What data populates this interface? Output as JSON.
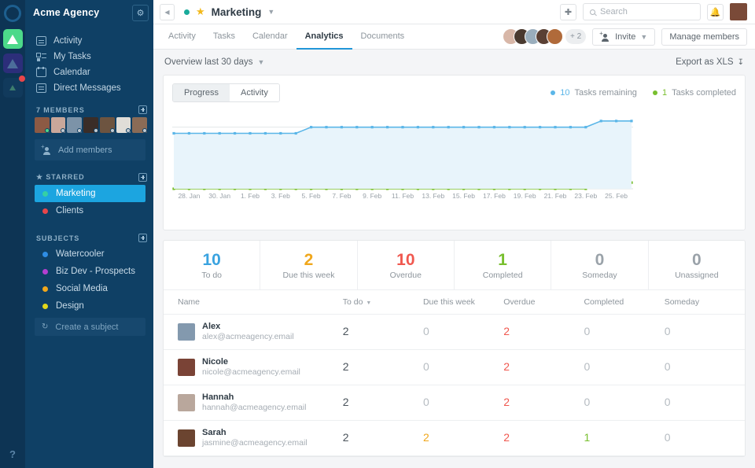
{
  "rail": {
    "logo": "circle-logo",
    "tiles": [
      {
        "name": "workspace-acme",
        "icon": "triangle-icon",
        "color": "#4cd98a",
        "badge": false
      },
      {
        "name": "workspace-purple",
        "icon": "triangle-icon",
        "color": "#2c2e7a",
        "badge": false
      },
      {
        "name": "workspace-dark",
        "icon": "triangle-icon",
        "color": "#113a5c",
        "badge": true
      }
    ],
    "help_label": "?"
  },
  "sidebar": {
    "title": "Acme Agency",
    "settings_icon": "gear-icon",
    "nav": [
      {
        "label": "Activity",
        "icon": "activity-icon"
      },
      {
        "label": "My Tasks",
        "icon": "tasks-icon"
      },
      {
        "label": "Calendar",
        "icon": "calendar-icon"
      },
      {
        "label": "Direct Messages",
        "icon": "message-icon"
      }
    ],
    "members_section": {
      "label": "7 MEMBERS",
      "add_icon": "plus-square-icon",
      "avatars": [
        {
          "name": "member-1",
          "color": "#8c5a44",
          "status": "#4cd98a"
        },
        {
          "name": "member-2",
          "color": "#c9a79a",
          "status": "#c4cbd1"
        },
        {
          "name": "member-3",
          "color": "#7c93a8",
          "status": "#c4cbd1"
        },
        {
          "name": "member-4",
          "color": "#3a2d28",
          "status": "#c4cbd1"
        },
        {
          "name": "member-5",
          "color": "#6d5440",
          "status": "#c4cbd1"
        },
        {
          "name": "member-6",
          "color": "#e0ddd8",
          "status": "#c4cbd1"
        },
        {
          "name": "member-7",
          "color": "#8a6b56",
          "status": "#c4cbd1"
        }
      ],
      "add_members_label": "Add members",
      "add_members_icon": "person-plus-icon"
    },
    "starred_section": {
      "label": "STARRED",
      "star_icon": "star-icon",
      "add_icon": "plus-square-icon",
      "items": [
        {
          "label": "Marketing",
          "color": "#35d0a5",
          "active": true
        },
        {
          "label": "Clients",
          "color": "#e8464a",
          "active": false
        }
      ]
    },
    "subjects_section": {
      "label": "SUBJECTS",
      "add_icon": "plus-square-icon",
      "items": [
        {
          "label": "Watercooler",
          "color": "#2f8de4",
          "active": false
        },
        {
          "label": "Biz Dev - Prospects",
          "color": "#b43fd0",
          "active": false
        },
        {
          "label": "Social Media",
          "color": "#f0a71c",
          "active": false
        },
        {
          "label": "Design",
          "color": "#e2d71a",
          "active": false
        }
      ],
      "create_label": "Create a subject",
      "create_icon": "refresh-icon"
    }
  },
  "topbar": {
    "collapse_icon": "chevron-left-icon",
    "project_dot_color": "#1aab9b",
    "star_icon": "star-icon",
    "project_name": "Marketing",
    "project_caret_icon": "chevron-down-icon",
    "add_icon": "plus-icon",
    "search_placeholder": "Search",
    "search_icon": "search-icon",
    "search_value": "",
    "bell_icon": "bell-icon",
    "user_avatar": "current-user-avatar"
  },
  "tabs": [
    {
      "label": "Activity",
      "active": false
    },
    {
      "label": "Tasks",
      "active": false
    },
    {
      "label": "Calendar",
      "active": false
    },
    {
      "label": "Analytics",
      "active": true
    },
    {
      "label": "Documents",
      "active": false
    }
  ],
  "tabbar_right": {
    "member_avatars": [
      {
        "name": "tab-member-1",
        "color": "#d8b7a8"
      },
      {
        "name": "tab-member-2",
        "color": "#4a3a30"
      },
      {
        "name": "tab-member-3",
        "color": "#9aaebd"
      },
      {
        "name": "tab-member-4",
        "color": "#5a4034"
      },
      {
        "name": "tab-member-5",
        "color": "#b06a3a"
      }
    ],
    "overflow_label": "+ 2",
    "invite_label": "Invite",
    "invite_icon": "person-plus-icon",
    "invite_caret_icon": "chevron-down-icon",
    "manage_label": "Manage members"
  },
  "overview": {
    "range_label": "Overview last 30 days",
    "range_caret_icon": "chevron-down-icon",
    "export_label": "Export as XLS",
    "export_icon": "download-icon"
  },
  "chart_panel": {
    "segments": [
      {
        "label": "Progress",
        "active": true
      },
      {
        "label": "Activity",
        "active": false
      }
    ],
    "legend": [
      {
        "value": "10",
        "label": "Tasks remaining",
        "color": "#5bb6e8"
      },
      {
        "value": "1",
        "label": "Tasks completed",
        "color": "#78bf2e"
      }
    ]
  },
  "chart_data": {
    "type": "area",
    "title": "",
    "xlabel": "",
    "ylabel": "",
    "grid": false,
    "legend_position": "top-right",
    "ylim": [
      0,
      12
    ],
    "x": [
      "27. Jan",
      "28. Jan",
      "29. Jan",
      "30. Jan",
      "31. Jan",
      "1. Feb",
      "2. Feb",
      "3. Feb",
      "4. Feb",
      "5. Feb",
      "6. Feb",
      "7. Feb",
      "8. Feb",
      "9. Feb",
      "10. Feb",
      "11. Feb",
      "12. Feb",
      "13. Feb",
      "14. Feb",
      "15. Feb",
      "16. Feb",
      "17. Feb",
      "18. Feb",
      "19. Feb",
      "20. Feb",
      "21. Feb",
      "22. Feb",
      "23. Feb",
      "24. Feb",
      "25. Feb",
      "26. Feb"
    ],
    "tick_labels": [
      "28. Jan",
      "30. Jan",
      "1. Feb",
      "3. Feb",
      "5. Feb",
      "7. Feb",
      "9. Feb",
      "11. Feb",
      "13. Feb",
      "15. Feb",
      "17. Feb",
      "19. Feb",
      "21. Feb",
      "23. Feb",
      "25. Feb"
    ],
    "series": [
      {
        "name": "Tasks remaining",
        "color": "#5bb6e8",
        "fill": "#e8f4fb",
        "values": [
          9,
          9,
          9,
          9,
          9,
          9,
          9,
          9,
          9,
          10,
          10,
          10,
          10,
          10,
          10,
          10,
          10,
          10,
          10,
          10,
          10,
          10,
          10,
          10,
          10,
          10,
          10,
          10,
          11,
          11,
          11
        ]
      },
      {
        "name": "Tasks completed",
        "color": "#78bf2e",
        "fill": "#eef6e4",
        "values": [
          0,
          0,
          0,
          0,
          0,
          0,
          0,
          0,
          0,
          0,
          0,
          0,
          0,
          0,
          0,
          0,
          0,
          0,
          0,
          0,
          0,
          0,
          0,
          0,
          0,
          0,
          0,
          0,
          1,
          1,
          1
        ]
      }
    ]
  },
  "stats": [
    {
      "value": "10",
      "label": "To do",
      "color": "#3aa3e0"
    },
    {
      "value": "2",
      "label": "Due this week",
      "color": "#f0a71c"
    },
    {
      "value": "10",
      "label": "Overdue",
      "color": "#f0584f"
    },
    {
      "value": "1",
      "label": "Completed",
      "color": "#78bf2e"
    },
    {
      "value": "0",
      "label": "Someday",
      "color": "#9aa2a9"
    },
    {
      "value": "0",
      "label": "Unassigned",
      "color": "#9aa2a9"
    }
  ],
  "table": {
    "columns": [
      "Name",
      "To do",
      "Due this week",
      "Overdue",
      "Completed",
      "Someday"
    ],
    "sorted_column": "To do",
    "sort_icon": "caret-down-icon",
    "rows": [
      {
        "name": "Alex",
        "email": "alex@acmeagency.email",
        "avatar_color": "#8399ae",
        "todo": "2",
        "due": "0",
        "overdue": "2",
        "completed": "0",
        "someday": "0"
      },
      {
        "name": "Nicole",
        "email": "nicole@acmeagency.email",
        "avatar_color": "#7a4336",
        "todo": "2",
        "due": "0",
        "overdue": "2",
        "completed": "0",
        "someday": "0"
      },
      {
        "name": "Hannah",
        "email": "hannah@acmeagency.email",
        "avatar_color": "#b9a79c",
        "todo": "2",
        "due": "0",
        "overdue": "2",
        "completed": "0",
        "someday": "0"
      },
      {
        "name": "Sarah",
        "email": "jasmine@acmeagency.email",
        "avatar_color": "#6b4430",
        "todo": "2",
        "due": "2",
        "overdue": "2",
        "completed": "1",
        "someday": "0"
      }
    ]
  }
}
